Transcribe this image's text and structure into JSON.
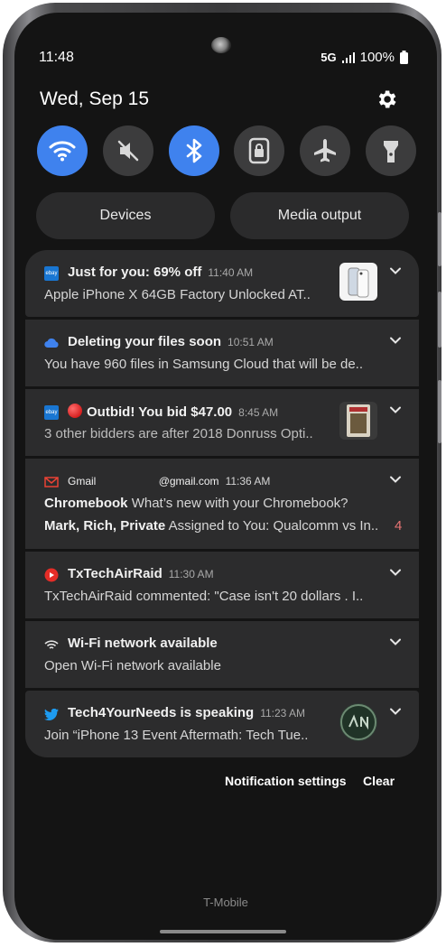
{
  "status_bar": {
    "time": "11:48",
    "network": "5G",
    "battery": "100%"
  },
  "header": {
    "date": "Wed, Sep 15"
  },
  "quick_settings": [
    {
      "name": "wifi",
      "state": "on",
      "icon": "wifi-icon"
    },
    {
      "name": "mute",
      "state": "off",
      "icon": "mute-icon"
    },
    {
      "name": "bluetooth",
      "state": "on",
      "icon": "bluetooth-icon"
    },
    {
      "name": "screen-lock",
      "state": "off",
      "icon": "lock-rotation-icon"
    },
    {
      "name": "airplane",
      "state": "off",
      "icon": "airplane-icon"
    },
    {
      "name": "flashlight",
      "state": "off",
      "icon": "flashlight-icon"
    }
  ],
  "buttons": {
    "devices": "Devices",
    "media_output": "Media output"
  },
  "notifications": [
    {
      "app_icon": "ebay-icon",
      "title": "Just for you: 69% off",
      "time": "11:40 AM",
      "body": "Apple iPhone X 64GB Factory Unlocked AT..",
      "thumb": "iphone-thumbnail"
    },
    {
      "app_icon": "samsung-cloud-icon",
      "title": "Deleting your files soon",
      "time": "10:51 AM",
      "body": "You have 960 files in Samsung Cloud that will be de.."
    },
    {
      "app_icon": "ebay-icon",
      "title": "Outbid! You bid $47.00",
      "time": "8:45 AM",
      "body": "3 other bidders are after 2018 Donruss Opti..",
      "thumb": "card-thumbnail",
      "badge": "red-dot-icon"
    },
    {
      "app_icon": "gmail-icon",
      "app_name": "Gmail",
      "account": "@gmail.com",
      "time": "11:36 AM",
      "line1_bold": "Chromebook",
      "line1_rest": "What’s new with your Chromebook?",
      "line2_bold": "Mark, Rich, Private",
      "line2_rest": "Assigned to You: Qualcomm vs In..",
      "count": "4"
    },
    {
      "app_icon": "youtube-icon",
      "title": "TxTechAirRaid",
      "time": "11:30 AM",
      "body": "TxTechAirRaid commented: \"Case isn't 20 dollars . I.."
    },
    {
      "app_icon": "wifi-icon",
      "title": "Wi-Fi network available",
      "time": "",
      "body": "Open Wi-Fi network available"
    },
    {
      "app_icon": "twitter-icon",
      "title": "Tech4YourNeeds is speaking",
      "time": "11:23 AM",
      "body": "Join “iPhone 13 Event Aftermath: Tech Tue..",
      "thumb": "avatar-thumbnail"
    }
  ],
  "footer": {
    "settings": "Notification settings",
    "clear": "Clear"
  },
  "carrier": "T-Mobile",
  "colors": {
    "accent": "#3f82ee",
    "card": "#2c2c2d",
    "background": "#141414"
  }
}
